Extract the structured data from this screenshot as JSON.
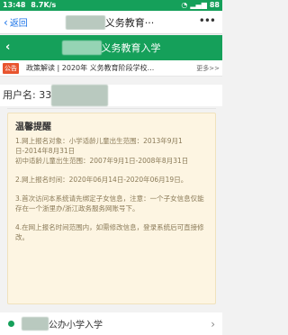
{
  "status_bar": {
    "time": "13:48",
    "speed": "8.7K/s",
    "battery": "88"
  },
  "top_nav": {
    "back_label": "返回",
    "title_suffix": "义务教育···"
  },
  "header": {
    "title_suffix": "义务教育入学"
  },
  "notice": {
    "tag": "公告",
    "text": "政策解读 | 2020年 义务教育阶段学校...",
    "more": "更多>>"
  },
  "user": {
    "label": "用户名: 33"
  },
  "tips": {
    "title": "温馨提醒",
    "p1": "1.网上报名对象：小学适龄儿童出生范围：2013年9月1日-2014年8月31日",
    "p1b": "初中适龄儿童出生范围：2007年9月1日-2008年8月31日",
    "p2": "2.网上报名时间：2020年06月14日-2020年06月19日。",
    "p3": "3.首次访问本系统请先绑定子女信息，注意：一个子女信息仅能存在一个浙里办/浙江政务服务网账号下。",
    "p4": "4.在网上报名时间范围内，如需修改信息，登录系统后可直接修改。"
  },
  "school_entry": {
    "label_suffix": "公办小学入学"
  }
}
